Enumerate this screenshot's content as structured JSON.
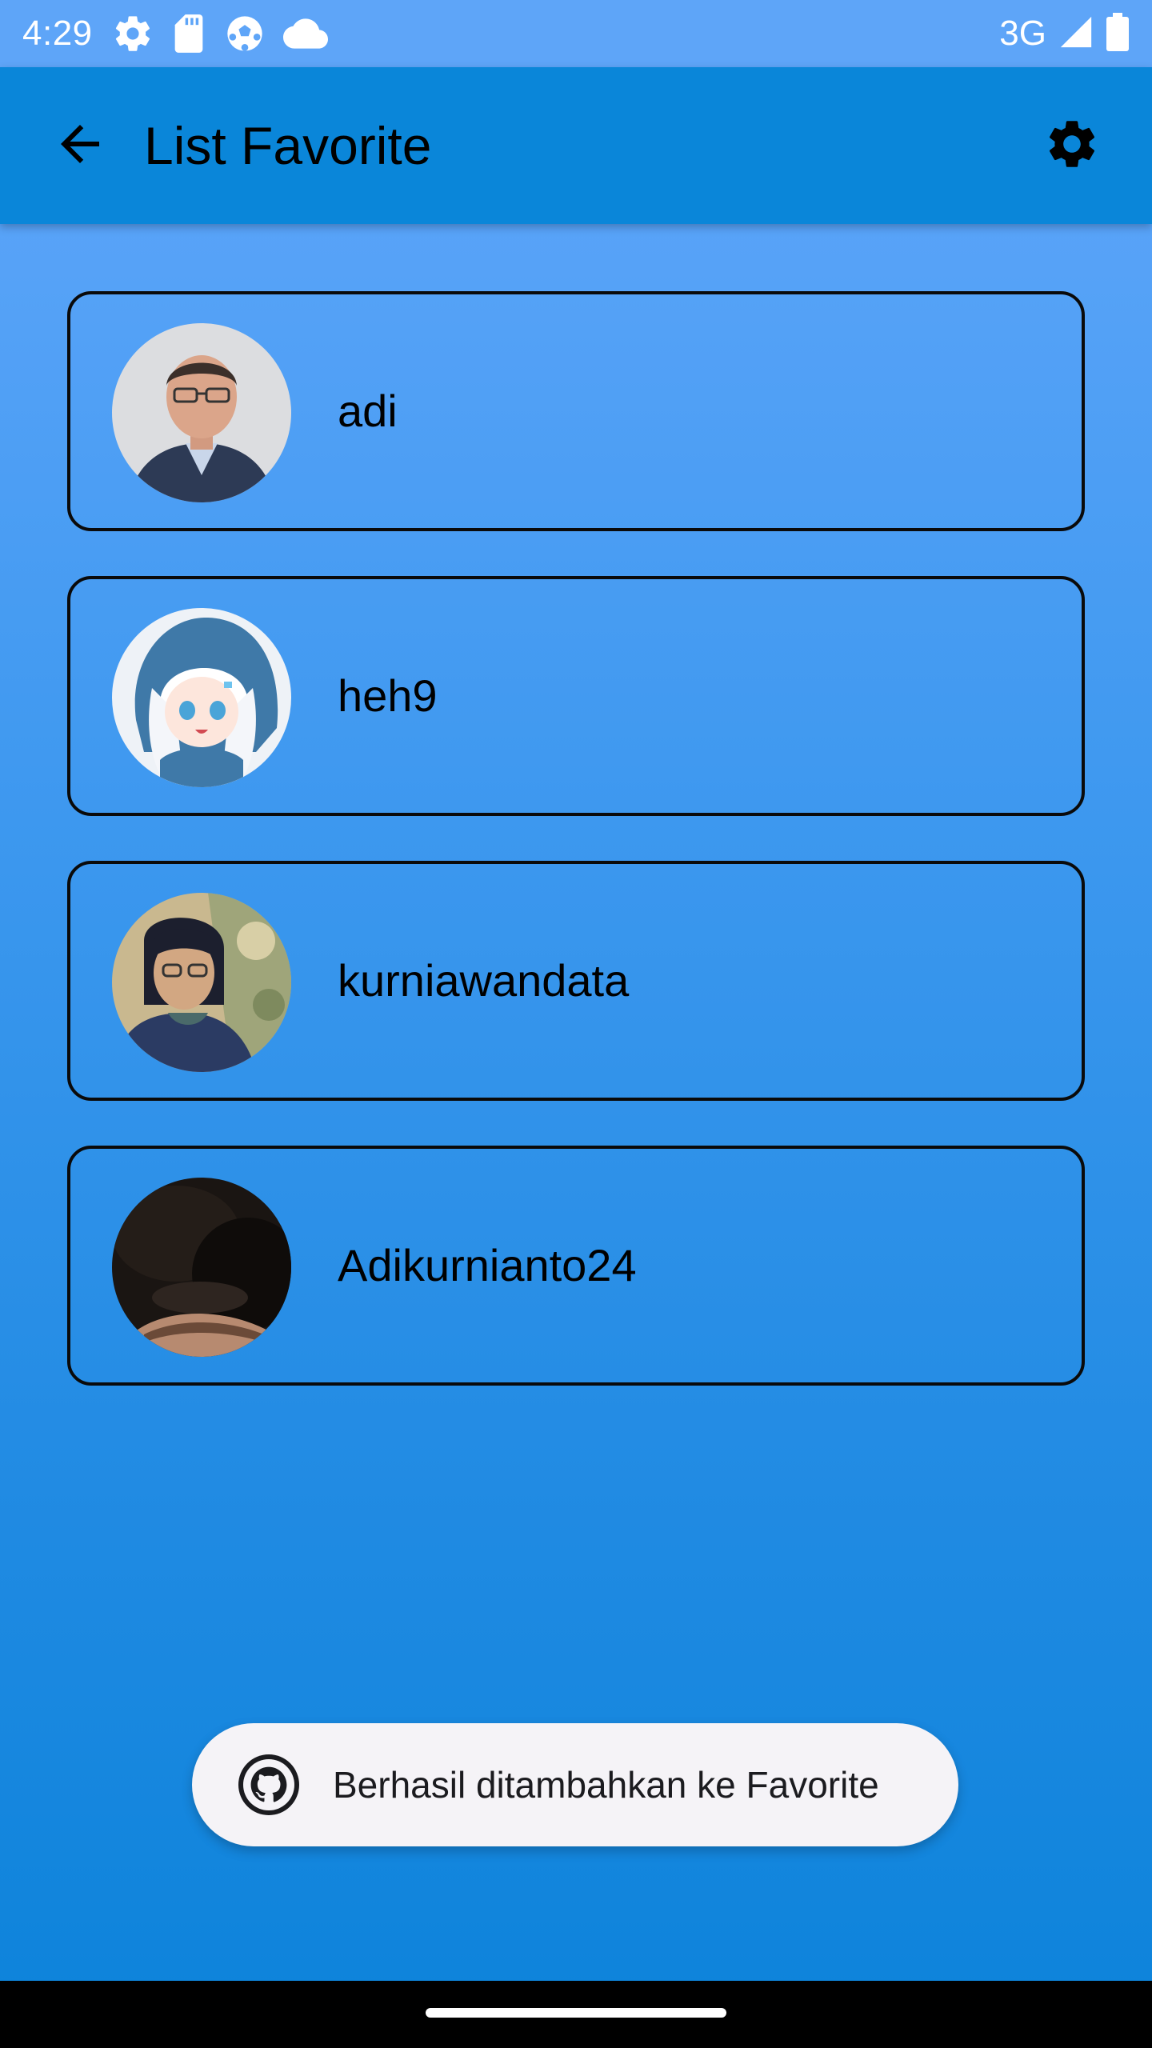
{
  "status_bar": {
    "time": "4:29",
    "network": "3G",
    "icons": [
      "settings-gear-icon",
      "sd-card-icon",
      "soccer-ball-icon",
      "cloud-icon",
      "signal-icon",
      "battery-icon"
    ]
  },
  "app_bar": {
    "title": "List Favorite",
    "back_icon": "arrow-back-icon",
    "settings_icon": "gear-icon",
    "color": "#0a86d9"
  },
  "favorites": [
    {
      "username": "adi",
      "avatar": "avatar-photo-man-glasses"
    },
    {
      "username": "heh9",
      "avatar": "avatar-anime-shark-hoodie"
    },
    {
      "username": "kurniawandata",
      "avatar": "avatar-photo-man-glasses-outdoor"
    },
    {
      "username": "Adikurnianto24",
      "avatar": "avatar-photo-dark-blurred"
    }
  ],
  "toast": {
    "message": "Berhasil ditambahkan ke Favorite",
    "icon": "github-icon"
  },
  "colors": {
    "background_top": "#62a7fb",
    "background_bottom": "#0c83da",
    "card_border": "#0a0a0a",
    "toast_bg": "#f5f3f7"
  }
}
